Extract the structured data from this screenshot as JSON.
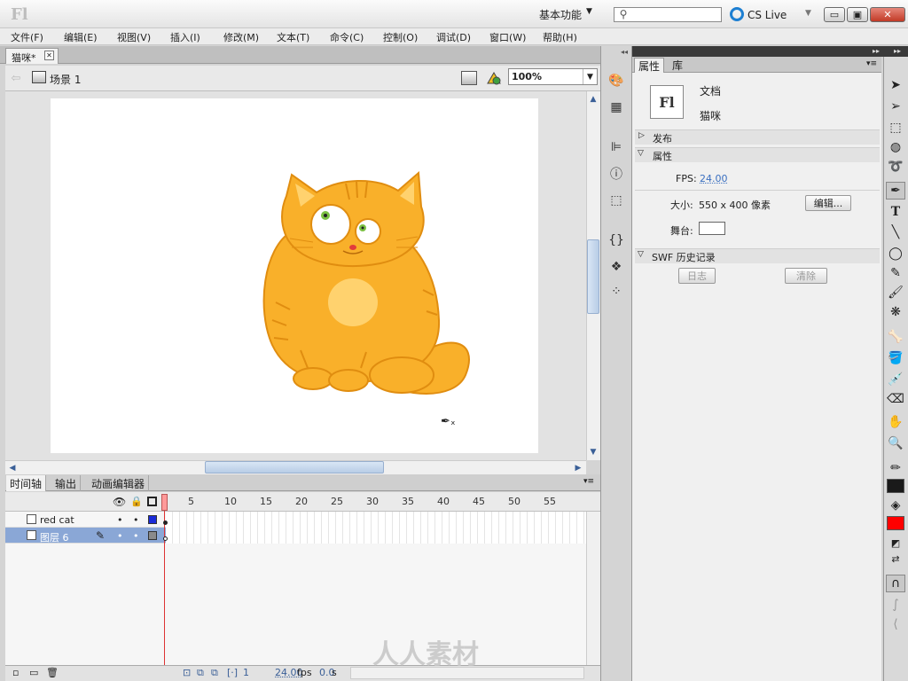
{
  "app": {
    "logo": "Fl",
    "workspace": "基本功能",
    "cs_live": "CS Live"
  },
  "window": {
    "minimize": "▭",
    "restore": "▣",
    "close": "✕"
  },
  "menu": [
    "文件(F)",
    "编辑(E)",
    "视图(V)",
    "插入(I)",
    "修改(M)",
    "文本(T)",
    "命令(C)",
    "控制(O)",
    "调试(D)",
    "窗口(W)",
    "帮助(H)"
  ],
  "document": {
    "tab": "猫咪*",
    "scene": "场景 1",
    "zoom": "100%"
  },
  "timeline": {
    "tabs": [
      "时间轴",
      "输出",
      "动画编辑器"
    ],
    "frame_numbers": [
      "5",
      "10",
      "15",
      "20",
      "25",
      "30",
      "35",
      "40",
      "45",
      "50",
      "55"
    ],
    "layers": [
      {
        "name": "red cat",
        "color": "#1a2bd8",
        "selected": false
      },
      {
        "name": "图层 6",
        "color": "#8a8a8a",
        "selected": true
      }
    ],
    "current_frame": "1",
    "fps": "24.00",
    "fps_unit": "fps",
    "time": "0.0",
    "time_unit": "s"
  },
  "properties": {
    "tabs": [
      "属性",
      "库"
    ],
    "doc_icon": "Fl",
    "doc_type": "文档",
    "doc_name": "猫咪",
    "publish_section": "发布",
    "props_section": "属性",
    "fps_label": "FPS:",
    "fps_value": "24.00",
    "size_label": "大小:",
    "size_value": "550 x 400 像素",
    "edit_button": "编辑...",
    "stage_label": "舞台:",
    "stage_color": "#ffffff",
    "swf_section": "SWF 历史记录",
    "log_button": "日志",
    "clear_button": "清除"
  },
  "colors": {
    "stroke": "#1a1a1a",
    "fill": "#ff0000",
    "cat_body": "#f9b02a",
    "cat_light": "#ffd26e",
    "cat_outline": "#e08d10"
  },
  "watermark": "人人素材"
}
